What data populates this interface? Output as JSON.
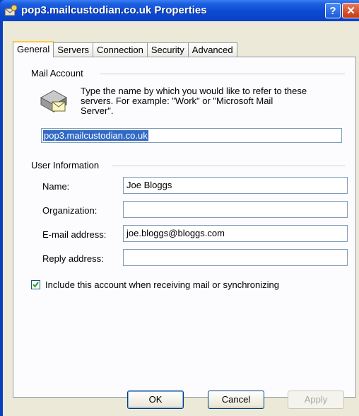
{
  "window": {
    "title": "pop3.mailcustodian.co.uk Properties",
    "help_glyph": "?",
    "close_glyph": "✕"
  },
  "tabs": [
    {
      "label": "General",
      "active": true
    },
    {
      "label": "Servers",
      "active": false
    },
    {
      "label": "Connection",
      "active": false
    },
    {
      "label": "Security",
      "active": false
    },
    {
      "label": "Advanced",
      "active": false
    }
  ],
  "mail_account": {
    "group_label": "Mail Account",
    "icon": "mail-envelope-icon",
    "description_line1": "Type the name by which you would like to refer to these",
    "description_line2": "servers.  For example: \"Work\" or \"Microsoft Mail",
    "description_line3": "Server\".",
    "account_name": "pop3.mailcustodian.co.uk"
  },
  "user_information": {
    "group_label": "User Information",
    "name_label": "Name:",
    "name_value": "Joe Bloggs",
    "organization_label": "Organization:",
    "organization_value": "",
    "email_label": "E-mail address:",
    "email_value": "joe.bloggs@bloggs.com",
    "reply_label": "Reply address:",
    "reply_value": ""
  },
  "include_account": {
    "label": "Include this account when receiving mail or synchronizing",
    "checked": true
  },
  "buttons": {
    "ok": "OK",
    "cancel": "Cancel",
    "apply": "Apply"
  },
  "colors": {
    "titlebar": "#0b4ad4",
    "face": "#ece9d8",
    "selection": "#316ac5"
  }
}
